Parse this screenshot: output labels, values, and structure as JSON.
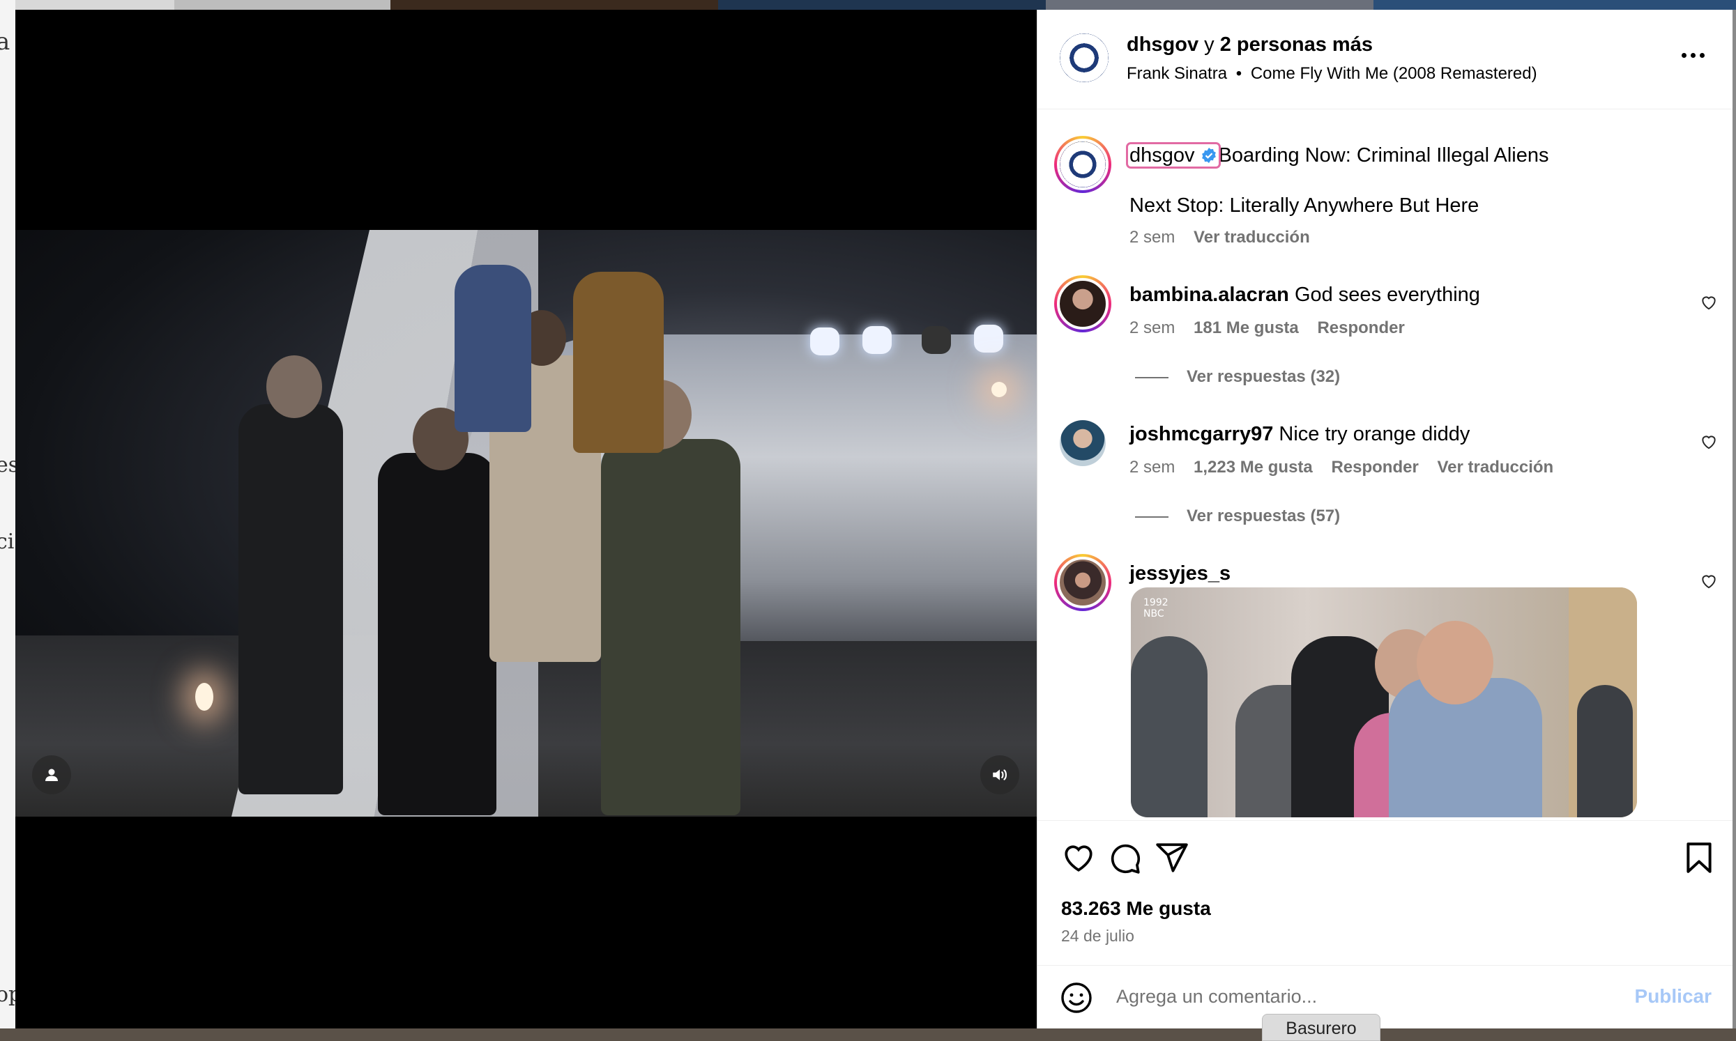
{
  "post": {
    "header": {
      "author": "dhsgov",
      "coauthors_text": " y ",
      "coauthors_bold": "2 personas más",
      "music_artist": "Frank Sinatra",
      "music_separator": "•",
      "music_title": "Come Fly With Me (2008 Remastered)"
    },
    "caption": {
      "username": "dhsgov",
      "line1": "Boarding Now: Criminal Illegal Aliens",
      "line2": "Next Stop: Literally Anywhere But Here",
      "time": "2 sem",
      "translate": "Ver traducción"
    },
    "comments": [
      {
        "username": "bambina.alacran",
        "text": "God sees everything",
        "time": "2 sem",
        "likes": "181 Me gusta",
        "reply": "Responder",
        "view_replies": "Ver respuestas (32)"
      },
      {
        "username": "joshmcgarry97",
        "text": "Nice try orange diddy",
        "time": "2 sem",
        "likes": "1,223 Me gusta",
        "reply": "Responder",
        "translate": "Ver traducción",
        "view_replies": "Ver respuestas (57)"
      },
      {
        "username": "jessyjes_s",
        "gif_badge": "1992",
        "gif_badge2": "NBC"
      }
    ],
    "likes_count": "83.263 Me gusta",
    "date": "24 de julio",
    "composer": {
      "placeholder": "Agrega un comentario...",
      "publish": "Publicar"
    }
  },
  "tooltip": "Basurero",
  "icons": [
    "user-icon",
    "volume-icon",
    "more-icon",
    "verified-icon",
    "heart-icon",
    "comment-icon",
    "share-icon",
    "bookmark-icon",
    "emoji-icon"
  ],
  "colors": {
    "verified": "#3897f0",
    "publish_disabled": "#a7c8f7",
    "meta": "#737373",
    "highlight": "#e26aa3"
  }
}
